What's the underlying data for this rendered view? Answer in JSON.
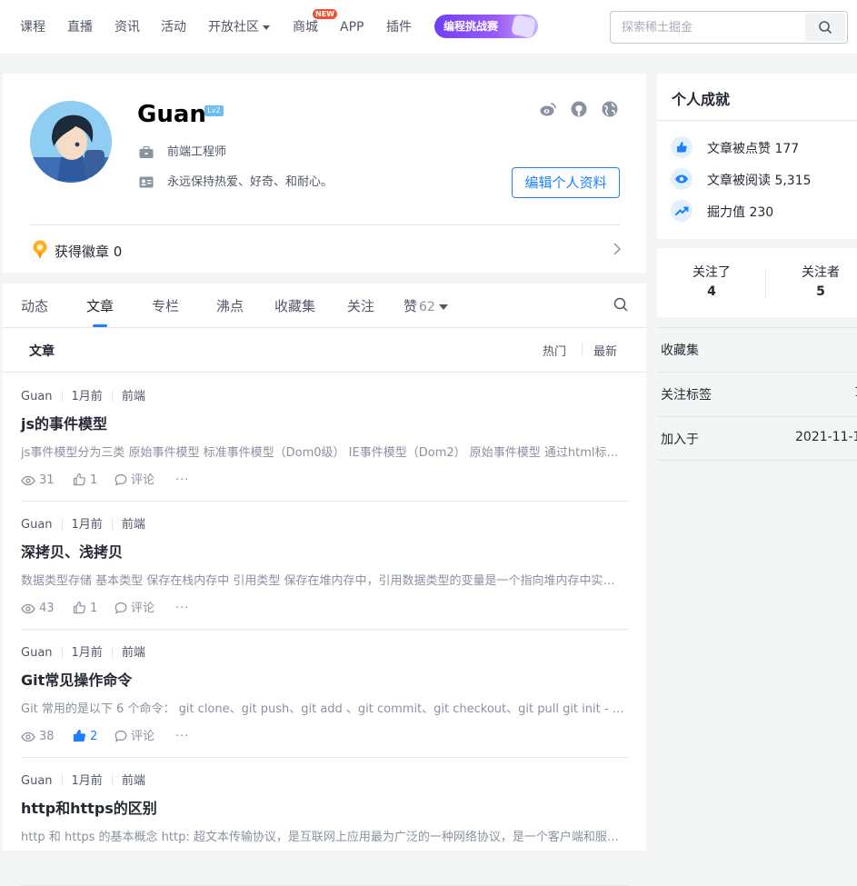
{
  "nav": {
    "items": [
      "课程",
      "直播",
      "资讯",
      "活动",
      "开放社区",
      "商城",
      "APP",
      "插件"
    ],
    "new_badge": "NEW",
    "promo": "编程挑战赛",
    "search_placeholder": "探索稀土掘金"
  },
  "profile": {
    "name": "Guan",
    "level": "Lv2",
    "job": "前端工程师",
    "bio": "永远保持热爱、好奇、和耐心。",
    "edit_label": "编辑个人资料",
    "medals_label": "获得徽章 0"
  },
  "tabs": {
    "items": [
      "动态",
      "文章",
      "专栏",
      "沸点",
      "收藏集",
      "关注"
    ],
    "likes_label": "赞",
    "likes_count": "62",
    "active_index": 1
  },
  "list_header": {
    "title": "文章",
    "sort_hot": "热门",
    "sort_new": "最新"
  },
  "articles": [
    {
      "author": "Guan",
      "time": "1月前",
      "tag": "前端",
      "title": "js的事件模型",
      "abstract": "js事件模型分为三类 原始事件模型 标准事件模型（Dom0级） IE事件模型（Dom2） 原始事件模型 通过html标签...",
      "views": "31",
      "likes": "1",
      "liked": false,
      "comment_label": "评论"
    },
    {
      "author": "Guan",
      "time": "1月前",
      "tag": "前端",
      "title": "深拷贝、浅拷贝",
      "abstract": "数据类型存储 基本类型 保存在栈内存中 引用类型 保存在堆内存中，引用数据类型的变量是一个指向堆内存中实际...",
      "views": "43",
      "likes": "1",
      "liked": false,
      "comment_label": "评论"
    },
    {
      "author": "Guan",
      "time": "1月前",
      "tag": "前端",
      "title": "Git常见操作命令",
      "abstract": "Git 常用的是以下 6 个命令： git clone、git push、git add 、git commit、git checkout、git pull git init - 初...",
      "views": "38",
      "likes": "2",
      "liked": true,
      "comment_label": "评论"
    },
    {
      "author": "Guan",
      "time": "1月前",
      "tag": "前端",
      "title": "http和https的区别",
      "abstract": "http 和 https 的基本概念 http: 超文本传输协议，是互联网上应用最为广泛的一种网络协议，是一个客户端和服务...",
      "views": "",
      "likes": "",
      "liked": false,
      "comment_label": ""
    }
  ],
  "achievements": {
    "title": "个人成就",
    "likes": "文章被点赞 177",
    "reads": "文章被阅读 5,315",
    "power": "掘力值 230"
  },
  "follow": {
    "following_label": "关注了",
    "following_count": "4",
    "followers_label": "关注者",
    "followers_count": "5"
  },
  "sidebar_rows": [
    {
      "key": "收藏集",
      "value": ""
    },
    {
      "key": "关注标签",
      "value": "1"
    },
    {
      "key": "加入于",
      "value": "2021-11-1"
    }
  ],
  "colors": {
    "accent": "#1e80ff",
    "text": "#252933",
    "muted": "#8a919f",
    "bg": "#f4f5f5"
  }
}
